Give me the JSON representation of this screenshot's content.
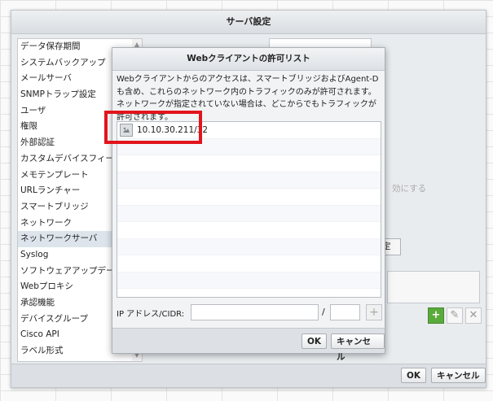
{
  "main_dialog": {
    "title": "サーバ設定",
    "sidebar_items": [
      "データ保存期間",
      "システムバックアップ",
      "メールサーバ",
      "SNMPトラップ設定",
      "ユーザ",
      "権限",
      "外部認証",
      "カスタムデバイスフィールド",
      "メモテンプレート",
      "URLランチャー",
      "スマートブリッジ",
      "ネットワーク",
      "ネットワークサーバ",
      "Syslog",
      "ソフトウェアアップデート",
      "Webプロキシ",
      "承認機能",
      "デバイスグループ",
      "Cisco API",
      "ラベル形式"
    ],
    "selected_item": "ネットワークサーバ",
    "disabled_option_text": "効にする",
    "partial_button_label": "定",
    "ok_label": "OK",
    "cancel_label": "キャンセル"
  },
  "overlay_dialog": {
    "title": "Webクライアントの許可リスト",
    "description": "Webクライアントからのアクセスは、スマートブリッジおよびAgent-Dも含め、これらのネットワーク内のトラフィックのみが許可されます。ネットワークが指定されていない場合は、どこからでもトラフィックが許可されます。",
    "entries": [
      "10.10.30.211/32"
    ],
    "ip_label": "IP アドレス/CIDR:",
    "ip_value": "",
    "cidr_value": "",
    "slash": "/",
    "ok_label": "OK",
    "cancel_label": "キャンセル"
  },
  "icons": {
    "host": "network-host-icon",
    "add": "plus-icon",
    "edit": "pencil-icon",
    "delete": "x-icon"
  },
  "colors": {
    "highlight": "#e2141c",
    "add_button": "#5aaa3c"
  }
}
